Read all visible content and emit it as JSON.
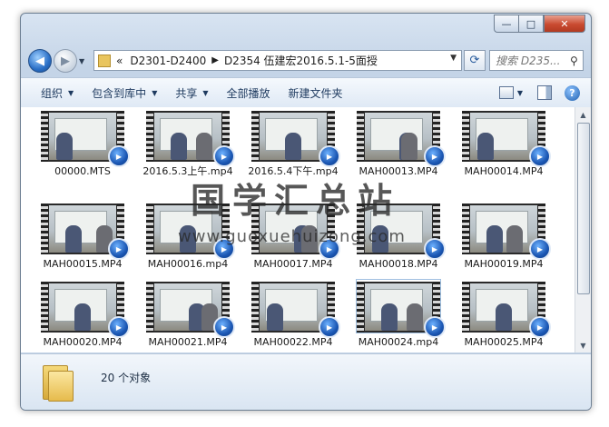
{
  "window": {
    "controls": {
      "minimize": "—",
      "maximize": "□",
      "close": "✕"
    }
  },
  "address": {
    "overflow": "«",
    "crumbs": [
      "D2301-D2400",
      "D2354 伍建宏2016.5.1-5面授"
    ],
    "search_placeholder": "搜索 D235..."
  },
  "toolbar": {
    "organize": "组织",
    "include_library": "包含到库中",
    "share": "共享",
    "play_all": "全部播放",
    "new_folder": "新建文件夹"
  },
  "files": [
    "00000.MTS",
    "2016.5.3上午.mp4",
    "2016.5.4下午.mp4",
    "MAH00013.MP4",
    "MAH00014.MP4",
    "MAH00015.MP4",
    "MAH00016.mp4",
    "MAH00017.MP4",
    "MAH00018.MP4",
    "MAH00019.MP4",
    "MAH00020.MP4",
    "MAH00021.MP4",
    "MAH00022.MP4",
    "MAH00024.mp4",
    "MAH00025.MP4"
  ],
  "selected_file": "MAH00024.mp4",
  "details": {
    "count": "20 个对象"
  },
  "watermark": {
    "title": "国学汇总站",
    "url": "www.guoxuehuizong.com"
  }
}
